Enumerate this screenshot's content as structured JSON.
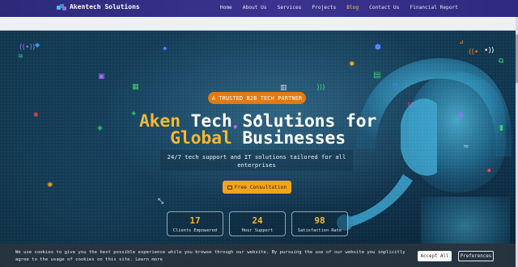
{
  "brand": {
    "name": "Akentech Solutions",
    "logo_icon": "company-logo-icon"
  },
  "nav": {
    "items": [
      {
        "label": "Home"
      },
      {
        "label": "About Us"
      },
      {
        "label": "Services"
      },
      {
        "label": "Projects"
      },
      {
        "label": "Blog",
        "active": true
      },
      {
        "label": "Contact Us"
      },
      {
        "label": "Financial Report"
      }
    ],
    "active_color": "#f4c23c"
  },
  "hero": {
    "badge": "A TRUSTED B2B TECH PARTNER",
    "headline_l1_a": "Aken",
    "headline_l1_b": " Tech Solutions for",
    "headline_l2_a": "Global",
    "headline_l2_b": " Businesses",
    "subtitle": "24/7 tech support and IT solutions tailored for all enterprises",
    "cta_label": "Free Consultation",
    "cta_icon": "calendar-icon",
    "accent_color": "#f5b82e",
    "stats": [
      {
        "value": "17",
        "label": "Clients Empowered"
      },
      {
        "value": "24",
        "label": "Hour Support"
      },
      {
        "value": "98",
        "label": "Satisfaction Rate"
      }
    ]
  },
  "cookie": {
    "text": "We use cookies to give you the best possible experience while you browse through our website. By pursuing the use of our website you implicitly agree to the usage of cookies on this site.",
    "learn_more": "Learn more",
    "accept": "Accept All",
    "preferences": "Preferences"
  }
}
